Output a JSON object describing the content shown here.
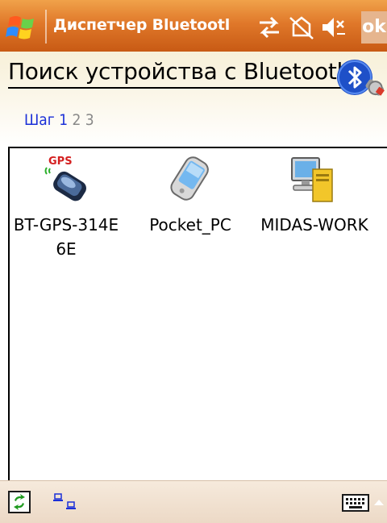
{
  "titlebar": {
    "title": "Диспетчер Bluetootl",
    "ok_label": "ok",
    "icons": [
      "windows-start-icon",
      "connectivity-icon",
      "no-sync-icon",
      "volume-muted-icon"
    ]
  },
  "header": {
    "heading": "Поиск устройства с Bluetooth",
    "icon": "bluetooth-search-icon"
  },
  "steps": {
    "label": "Шаг",
    "current": "1",
    "others": "2 3"
  },
  "devices": [
    {
      "name": "BT-GPS-314E6E",
      "icon": "gps-receiver-icon",
      "icon_text": "GPS"
    },
    {
      "name": "Pocket_PC",
      "icon": "pocket-pc-icon"
    },
    {
      "name": "MIDAS-WORK",
      "icon": "desktop-computer-icon"
    }
  ],
  "bottombar": {
    "icons": [
      "refresh-icon",
      "view-toggle-icon",
      "keyboard-icon",
      "input-menu-arrow-icon"
    ]
  },
  "colors": {
    "titlebar": "#e0782a",
    "step_active": "#1a2fd8",
    "step_inactive": "#888888"
  }
}
